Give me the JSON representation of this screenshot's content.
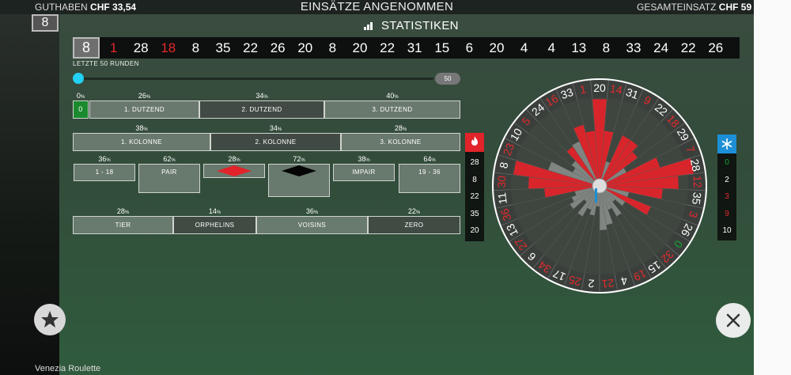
{
  "topbar": {
    "balance_label": "GUTHABEN",
    "balance_value": "CHF 33,54",
    "title": "EINSÄTZE ANGENOMMEN",
    "total_label": "GESAMTEINSATZ",
    "total_value": "CHF 59",
    "corner_tag": "8"
  },
  "stats": {
    "title": "STATISTIKEN",
    "results_subtitle": "LETZTE 50 RUNDEN",
    "slider_value": "50",
    "slider_fraction": 0.0
  },
  "results": [
    {
      "n": "8",
      "c": "white"
    },
    {
      "n": "1",
      "c": "red"
    },
    {
      "n": "28",
      "c": "white"
    },
    {
      "n": "18",
      "c": "red"
    },
    {
      "n": "8",
      "c": "white"
    },
    {
      "n": "35",
      "c": "white"
    },
    {
      "n": "22",
      "c": "white"
    },
    {
      "n": "26",
      "c": "white"
    },
    {
      "n": "20",
      "c": "white"
    },
    {
      "n": "8",
      "c": "white"
    },
    {
      "n": "20",
      "c": "white"
    },
    {
      "n": "22",
      "c": "white"
    },
    {
      "n": "31",
      "c": "white"
    },
    {
      "n": "15",
      "c": "white"
    },
    {
      "n": "6",
      "c": "white"
    },
    {
      "n": "20",
      "c": "white"
    },
    {
      "n": "4",
      "c": "white"
    },
    {
      "n": "4",
      "c": "white"
    },
    {
      "n": "13",
      "c": "white"
    },
    {
      "n": "8",
      "c": "white"
    },
    {
      "n": "33",
      "c": "white"
    },
    {
      "n": "24",
      "c": "white"
    },
    {
      "n": "22",
      "c": "white"
    },
    {
      "n": "26",
      "c": "white"
    }
  ],
  "zero": {
    "pct": "0",
    "label": "0"
  },
  "dozens": [
    {
      "pct": "26",
      "label": "1. DUTZEND"
    },
    {
      "pct": "34",
      "label": "2. DUTZEND"
    },
    {
      "pct": "40",
      "label": "3. DUTZEND"
    }
  ],
  "columns": [
    {
      "pct": "38",
      "label": "1. KOLONNE"
    },
    {
      "pct": "34",
      "label": "2. KOLONNE"
    },
    {
      "pct": "28",
      "label": "3. KOLONNE"
    }
  ],
  "even_chances": [
    {
      "pct": "36",
      "label": "1 - 18"
    },
    {
      "pct": "62",
      "label": "PAIR"
    },
    {
      "pct": "28",
      "label": "red-diamond"
    },
    {
      "pct": "72",
      "label": "black-diamond"
    },
    {
      "pct": "38",
      "label": "IMPAIR"
    },
    {
      "pct": "64",
      "label": "19 - 36"
    }
  ],
  "sectors": [
    {
      "pct": "28",
      "label": "TIER"
    },
    {
      "pct": "14",
      "label": "ORPHELINS"
    },
    {
      "pct": "36",
      "label": "VOISINS"
    },
    {
      "pct": "22",
      "label": "ZERO"
    }
  ],
  "hot_numbers": [
    "28",
    "8",
    "22",
    "35",
    "20"
  ],
  "cold_numbers": [
    {
      "n": "0",
      "c": "green"
    },
    {
      "n": "2",
      "c": "white"
    },
    {
      "n": "3",
      "c": "red"
    },
    {
      "n": "9",
      "c": "red"
    },
    {
      "n": "10",
      "c": "white"
    }
  ],
  "wheel_order": [
    "0",
    "32",
    "15",
    "19",
    "4",
    "21",
    "2",
    "25",
    "17",
    "34",
    "6",
    "27",
    "13",
    "36",
    "11",
    "30",
    "8",
    "23",
    "10",
    "5",
    "24",
    "16",
    "33",
    "1",
    "20",
    "14",
    "31",
    "9",
    "22",
    "18",
    "29",
    "7",
    "28",
    "12",
    "35",
    "3",
    "26"
  ],
  "wheel_red": [
    "32",
    "19",
    "21",
    "25",
    "34",
    "27",
    "36",
    "30",
    "23",
    "5",
    "16",
    "1",
    "14",
    "9",
    "18",
    "7",
    "12",
    "3"
  ],
  "wheel_hot": [
    "1",
    "14",
    "22",
    "18",
    "7",
    "28",
    "12",
    "35",
    "8",
    "30",
    "11",
    "24",
    "33",
    "20",
    "9",
    "26"
  ],
  "wheel_bars": [
    4,
    2,
    5,
    3,
    6,
    7,
    2,
    4,
    3,
    5,
    2,
    5,
    4,
    3,
    4,
    6,
    8,
    9,
    4,
    5,
    3,
    8,
    5,
    4,
    8,
    4,
    3,
    4,
    4,
    3,
    4,
    5,
    9,
    7,
    5,
    4,
    4
  ],
  "footer_text": "Venezia Roulette",
  "colors": {
    "accent_hot": "#e0242a",
    "accent_cold": "#1d8fd6",
    "slider": "#22d1f3"
  }
}
